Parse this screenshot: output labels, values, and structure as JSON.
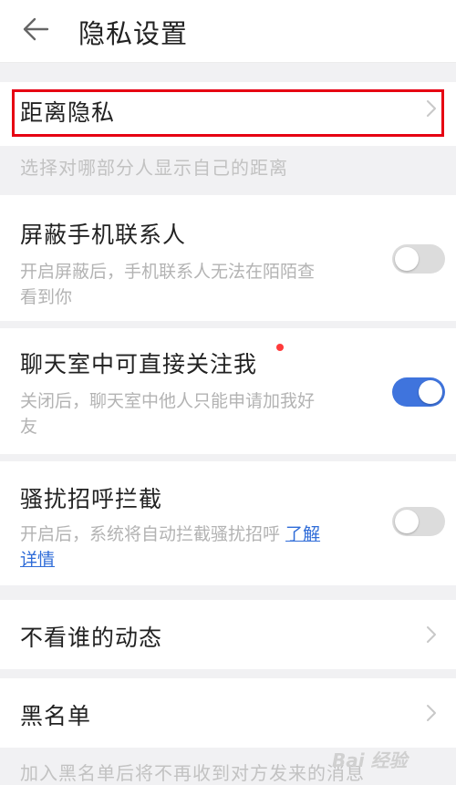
{
  "header": {
    "title": "隐私设置",
    "back_icon": "back-arrow-icon"
  },
  "distance_privacy": {
    "label": "距离隐私",
    "note": "选择对哪部分人显示自己的距离"
  },
  "block_contacts": {
    "title": "屏蔽手机联系人",
    "desc_line1": "开启屏蔽后，手机联系人无法在陌陌查",
    "desc_line2": "看到你",
    "enabled": false
  },
  "chatroom_follow": {
    "title": "聊天室中可直接关注我",
    "desc_line1": "关闭后，聊天室中他人只能申请加我好",
    "desc_line2": "友",
    "enabled": true
  },
  "harass_block": {
    "title": "骚扰招呼拦截",
    "desc_prefix": "开启后，系统将自动拦截骚扰招呼 ",
    "link_part1": "了解",
    "link_part2": "详情",
    "enabled": false
  },
  "hide_feed": {
    "label": "不看谁的动态"
  },
  "blacklist": {
    "label": "黑名单",
    "note": "加入黑名单后将不再收到对方发来的消息"
  },
  "watermark": {
    "text": "Bai 经验"
  },
  "colors": {
    "accent": "#3f74dd",
    "highlight": "#e60012",
    "link": "#2f6cd8",
    "toggle_off": "#dcdcdc",
    "background": "#f1f1f3"
  }
}
